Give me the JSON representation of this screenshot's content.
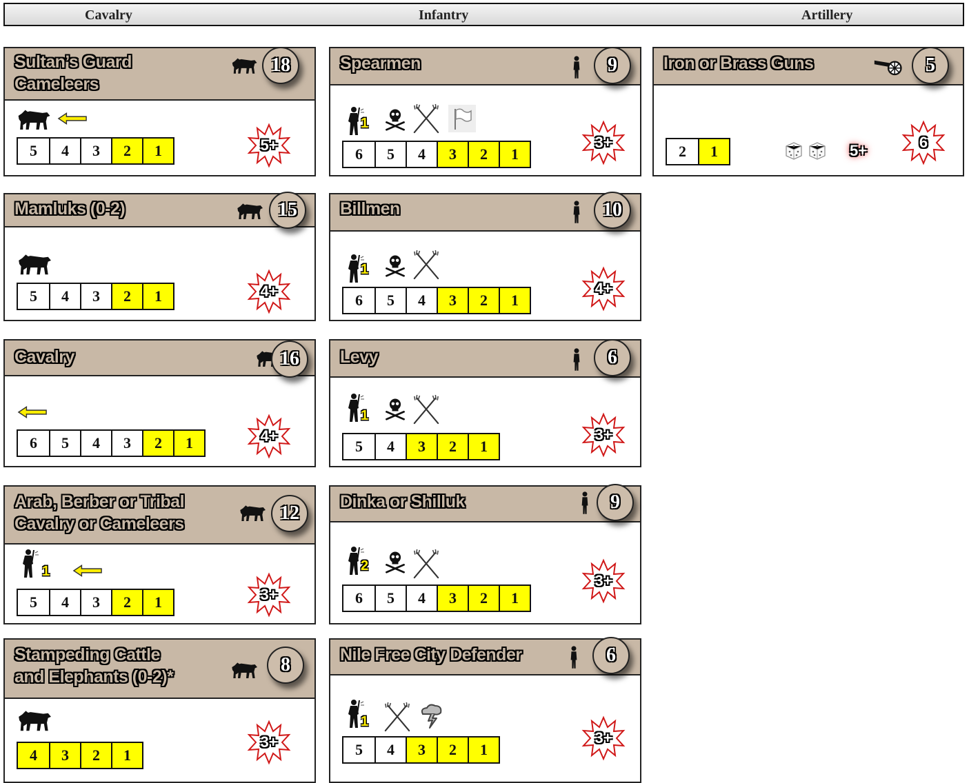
{
  "header": {
    "cavalry": "Cavalry",
    "infantry": "Infantry",
    "artillery": "Artillery"
  },
  "colors": {
    "title_bg": "#c8b8a6",
    "highlight_box": "#ffff00",
    "burst_outline": "#d01818"
  },
  "cards": {
    "sultans_guard": {
      "title1": "Sultan’s Guard",
      "title2": "Cameleers",
      "points": "18",
      "boxes": [
        "5",
        "4",
        "3",
        "2",
        "1"
      ],
      "save": "5+"
    },
    "mamluks": {
      "title1": "Mamluks (0-2)",
      "points": "15",
      "boxes": [
        "5",
        "4",
        "3",
        "2",
        "1"
      ],
      "save": "4+"
    },
    "cavalry": {
      "title1": "Cavalry",
      "points": "16",
      "boxes": [
        "6",
        "5",
        "4",
        "3",
        "2",
        "1"
      ],
      "save": "4+"
    },
    "arab": {
      "title1": "Arab, Berber or Tribal",
      "title2": "Cavalry or Cameleers",
      "points": "12",
      "fire": "1",
      "boxes": [
        "5",
        "4",
        "3",
        "2",
        "1"
      ],
      "save": "3+"
    },
    "cattle": {
      "title1": "Stampeding Cattle",
      "title2": "and Elephants (0-2)*",
      "points": "8",
      "boxes": [
        "4",
        "3",
        "2",
        "1"
      ],
      "save": "3+"
    },
    "spearmen": {
      "title1": "Spearmen",
      "points": "9",
      "fire": "1",
      "boxes": [
        "6",
        "5",
        "4",
        "3",
        "2",
        "1"
      ],
      "save": "3+"
    },
    "billmen": {
      "title1": "Billmen",
      "points": "10",
      "fire": "1",
      "boxes": [
        "6",
        "5",
        "4",
        "3",
        "2",
        "1"
      ],
      "save": "4+"
    },
    "levy": {
      "title1": "Levy",
      "points": "6",
      "fire": "1",
      "boxes": [
        "5",
        "4",
        "3",
        "2",
        "1"
      ],
      "save": "3+"
    },
    "dinka": {
      "title1": "Dinka or Shilluk",
      "points": "9",
      "fire": "2",
      "boxes": [
        "6",
        "5",
        "4",
        "3",
        "2",
        "1"
      ],
      "save": "3+"
    },
    "nile": {
      "title1": "Nile Free City Defender",
      "points": "6",
      "fire": "1",
      "boxes": [
        "5",
        "4",
        "3",
        "2",
        "1"
      ],
      "save": "3+"
    },
    "guns": {
      "title1": "Iron or Brass Guns",
      "points": "5",
      "boxes": [
        "2",
        "1"
      ],
      "hit": "5+",
      "save": "6"
    }
  },
  "icons": [
    "horse-icon",
    "soldier-icon",
    "cannon-icon",
    "skull-icon",
    "pitchfork-icon",
    "flag-icon",
    "arrow-left-icon",
    "rifleman-icon",
    "dice-icon",
    "storm-icon"
  ]
}
